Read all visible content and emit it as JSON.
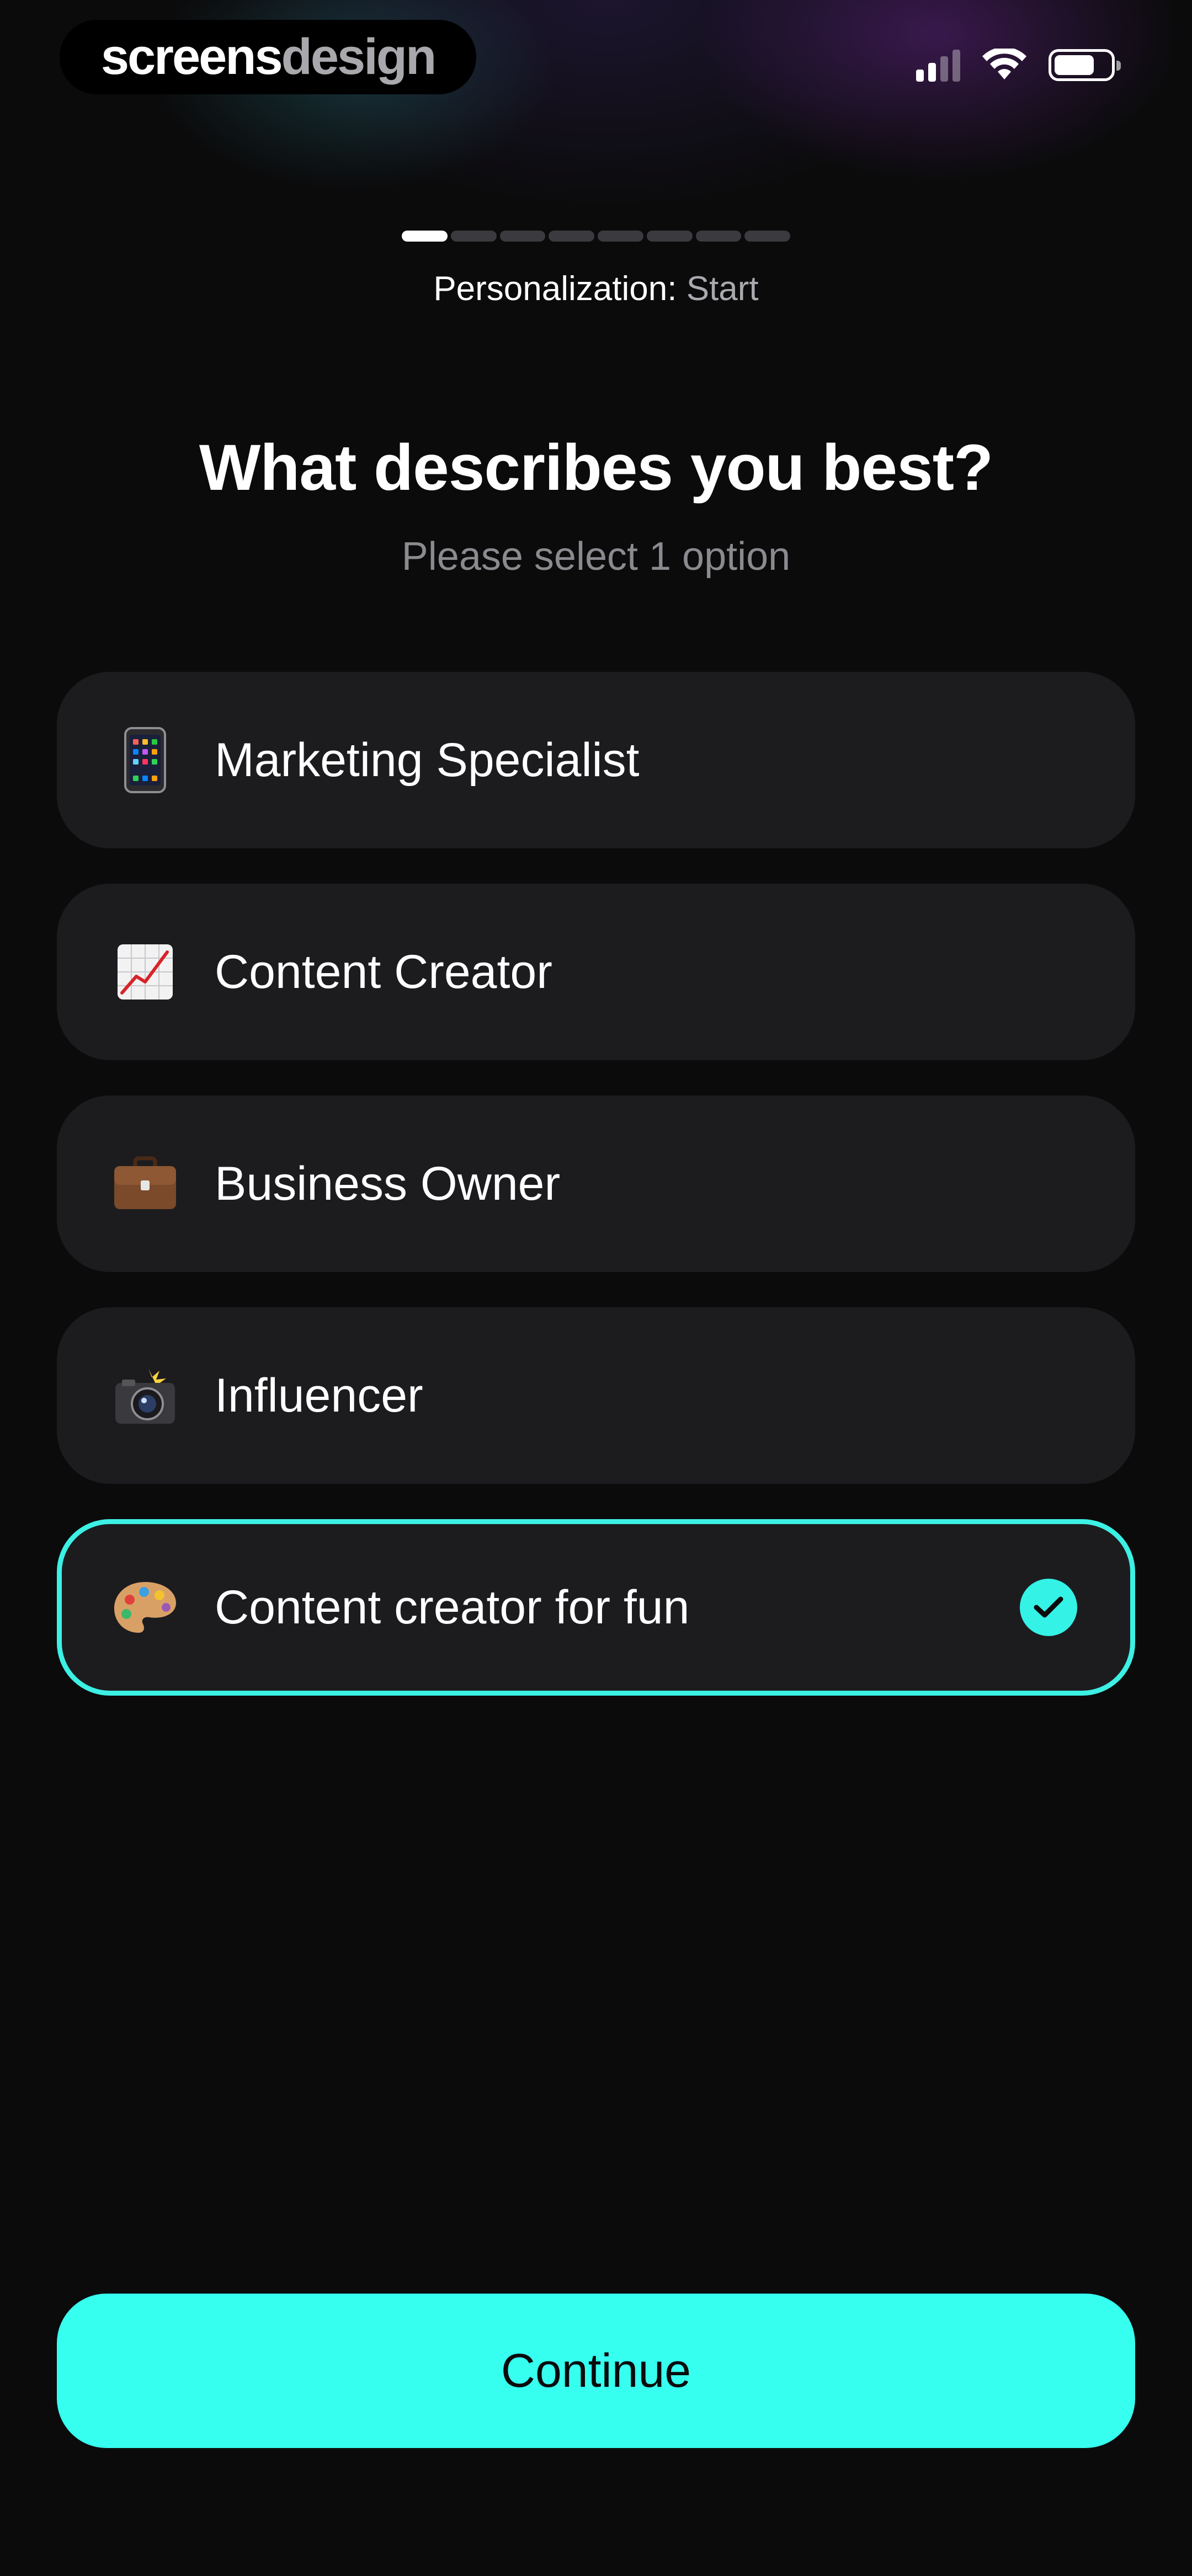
{
  "watermark": {
    "part1": "screens",
    "part2": "design"
  },
  "status_bar": {
    "icons": [
      "signal-icon",
      "wifi-icon",
      "battery-icon"
    ]
  },
  "progress": {
    "total_steps": 8,
    "completed_steps": 1
  },
  "step": {
    "label": "Personalization:",
    "value": "Start"
  },
  "header": {
    "title": "What describes you best?",
    "subtitle": "Please select 1 option"
  },
  "options": [
    {
      "label": "Marketing Specialist",
      "icon": "mobile-phone-icon",
      "selected": false
    },
    {
      "label": "Content Creator",
      "icon": "chart-increasing-icon",
      "selected": false
    },
    {
      "label": "Business Owner",
      "icon": "briefcase-icon",
      "selected": false
    },
    {
      "label": "Influencer",
      "icon": "camera-flash-icon",
      "selected": false
    },
    {
      "label": "Content creator for fun",
      "icon": "palette-icon",
      "selected": true
    }
  ],
  "footer": {
    "continue_label": "Continue"
  },
  "colors": {
    "accent": "#36fff0",
    "selected_border": "#3cf0e4",
    "card_bg": "#1c1c1f",
    "page_bg": "#0b0b0c"
  }
}
